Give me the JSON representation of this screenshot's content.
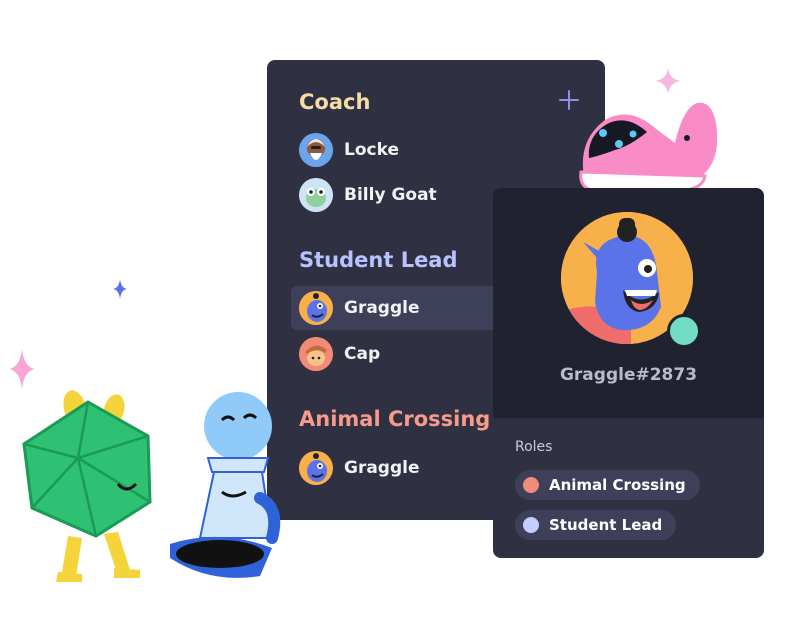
{
  "member_list": {
    "groups": [
      {
        "header": "Coach",
        "color": "#f7dca5",
        "members": [
          {
            "name": "Locke",
            "avatar": "locke-avatar"
          },
          {
            "name": "Billy Goat",
            "avatar": "billy-goat-avatar"
          }
        ]
      },
      {
        "header": "Student Lead",
        "color": "#b6c3ff",
        "members": [
          {
            "name": "Graggle",
            "avatar": "graggle-avatar",
            "selected": true
          },
          {
            "name": "Cap",
            "avatar": "cap-avatar"
          }
        ]
      },
      {
        "header": "Animal Crossing",
        "color": "#f59b8b",
        "members": [
          {
            "name": "Graggle",
            "avatar": "graggle-avatar"
          }
        ]
      }
    ],
    "add_icon": "plus-icon"
  },
  "profile": {
    "tag": "Graggle#2873",
    "roles_label": "Roles",
    "roles": [
      {
        "name": "Animal Crossing",
        "color": "#f08c7a"
      },
      {
        "name": "Student Lead",
        "color": "#c4cdff"
      }
    ]
  }
}
